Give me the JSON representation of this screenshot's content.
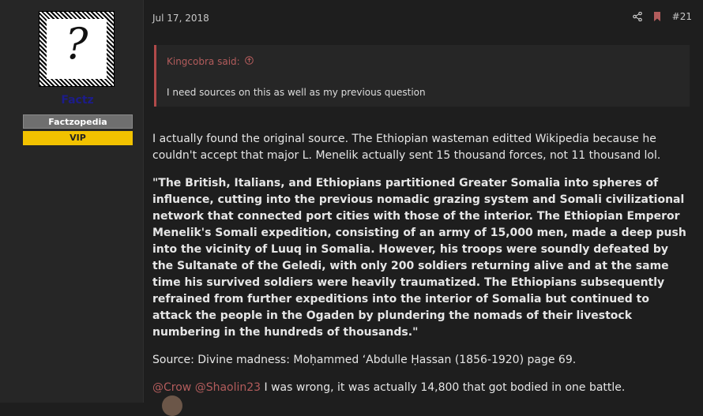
{
  "user": {
    "name": "Factz",
    "title": "Factzopedia",
    "badge": "VIP"
  },
  "post": {
    "date": "Jul 17, 2018",
    "number": "#21",
    "quote": {
      "author": "Kingcobra said:",
      "text": "I need sources on this as well as my previous question"
    },
    "p1": "I actually found the original source. The Ethiopian wasteman editted Wikipedia because he couldn't accept that major L. Menelik actually sent 15 thousand forces, not 11 thousand lol.",
    "p2": "\"The British, Italians, and Ethiopians partitioned Greater Somalia into spheres of influence, cutting into the previous nomadic grazing system and Somali civilizational network that connected port cities with those of the interior. The Ethiopian Emperor Menelik's Somali expedition, consisting of an army of 15,000 men, made a deep push into the vicinity of Luuq in Somalia. However, his troops were soundly defeated by the Sultanate of the Geledi, with only 200 soldiers returning alive and at the same time his survived soldiers were heavily traumatized. The Ethiopians subsequently refrained from further expeditions into the interior of Somalia but continued to attack the people in the Ogaden by plundering the nomads of their livestock numbering in the hundreds of thousands.\"",
    "p3": "Source: Divine madness: Moḥammed ʻAbdulle Ḥassan (1856-1920) page 69.",
    "mention1": "@Crow",
    "mention2": "@Shaolin23",
    "p4": " I was wrong, it was actually 14,800 that got bodied in one battle."
  },
  "colors": {
    "accent": "#b35c5c",
    "vip": "#f2c200"
  },
  "icons": [
    "share-icon",
    "bookmark-icon",
    "arrow-up-circle-icon"
  ]
}
